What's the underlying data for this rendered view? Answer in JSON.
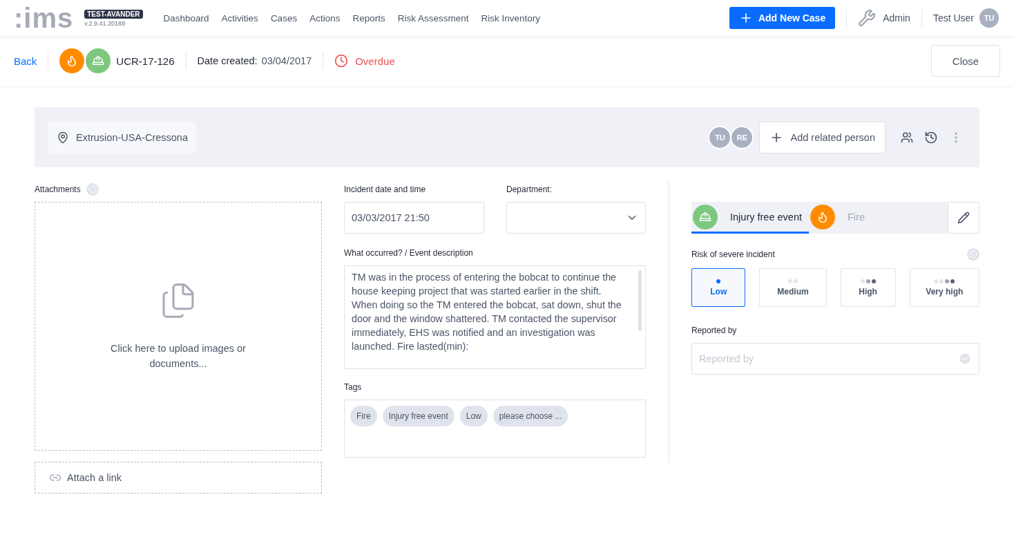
{
  "header": {
    "logo": ":ims",
    "env_badge": "TEST-AVANDER",
    "version": "v.2.9.41.20188",
    "nav": [
      "Dashboard",
      "Activities",
      "Cases",
      "Actions",
      "Reports",
      "Risk Assessment",
      "Risk Inventory"
    ],
    "add_button": "Add New Case",
    "admin": "Admin",
    "user": {
      "name": "Test User",
      "initials": "TU"
    }
  },
  "case_bar": {
    "back": "Back",
    "case_types": [
      {
        "kind": "fire"
      },
      {
        "kind": "injury"
      }
    ],
    "case_id": "UCR-17-126",
    "date_label": "Date created:",
    "date": "03/04/2017",
    "status": "Overdue",
    "close": "Close"
  },
  "location_bar": {
    "location": "Extrusion-USA-Cressona",
    "people": [
      {
        "initials": "TU"
      },
      {
        "initials": "RE"
      }
    ],
    "add_person": "Add related person"
  },
  "attachments": {
    "label": "Attachments",
    "upload_text": "Click here to upload images or documents...",
    "attach_link": "Attach a link"
  },
  "incident": {
    "date_label": "Incident date and time",
    "date_value": "03/03/2017 21:50",
    "department_label": "Department:",
    "description_label": "What occurred? / Event description",
    "description": "TM was in the process of entering the bobcat to continue the house keeping project that was started earlier in the shift. When doing so the TM entered the bobcat, sat down, shut the door and the window shattered. TM contacted the supervisor immediately, EHS was notified and an investigation was launched. Fire lasted(min):",
    "tags_label": "Tags",
    "tags": [
      "Fire",
      "Injury free event",
      "Low",
      "please choose ..."
    ]
  },
  "classification": {
    "tabs": [
      {
        "kind": "injury",
        "label": "Injury free event",
        "selected": true
      },
      {
        "kind": "fire",
        "label": "Fire",
        "selected": false
      }
    ]
  },
  "risk": {
    "label": "Risk of severe incident",
    "levels": [
      {
        "label": "Low",
        "selected": true
      },
      {
        "label": "Medium",
        "selected": false
      },
      {
        "label": "High",
        "selected": false
      },
      {
        "label": "Very high",
        "selected": false
      }
    ]
  },
  "reported_by": {
    "label": "Reported by",
    "placeholder": "Reported by"
  }
}
